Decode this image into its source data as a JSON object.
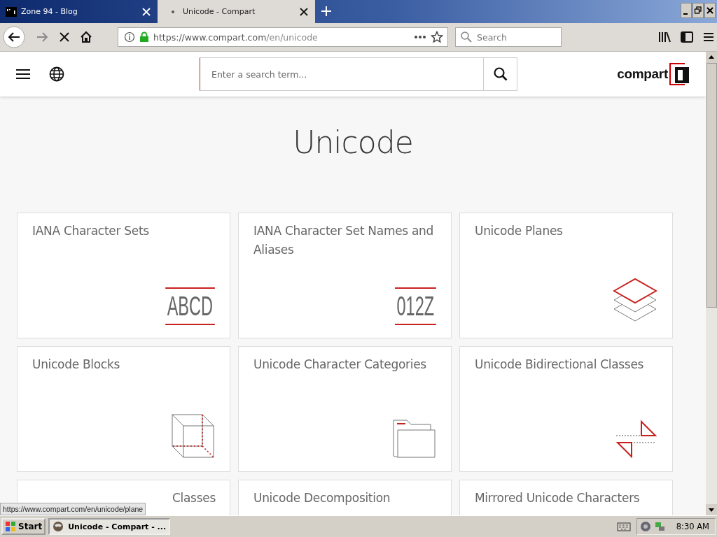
{
  "browser": {
    "tabs": [
      {
        "title": "Zone 94 - Blog",
        "selected": false
      },
      {
        "title": "Unicode - Compart",
        "selected": true,
        "loading": true
      }
    ],
    "url": {
      "host": "https://www.compart.com",
      "path": "/en/unicode"
    },
    "search_placeholder": "Search"
  },
  "site": {
    "search_placeholder": "Enter a search term...",
    "logo": "compart"
  },
  "page": {
    "title": "Unicode",
    "cards": [
      {
        "title": "IANA Character Sets",
        "kind": "letters",
        "glyphs": "ABCD"
      },
      {
        "title": "IANA Character Set Names and Aliases",
        "kind": "letters",
        "glyphs": "012Z"
      },
      {
        "title": "Unicode Planes",
        "kind": "planes"
      },
      {
        "title": "Unicode Blocks",
        "kind": "cube"
      },
      {
        "title": "Unicode Character Categories",
        "kind": "folder"
      },
      {
        "title": "Unicode Bidirectional Classes",
        "kind": "arrows"
      },
      {
        "title": "Classes",
        "kind": "covered"
      },
      {
        "title": "Unicode Decomposition",
        "kind": "plain"
      },
      {
        "title": "Mirrored Unicode Characters",
        "kind": "plain"
      }
    ]
  },
  "status_url": "https://www.compart.com/en/unicode/plane",
  "taskbar": {
    "start": "Start",
    "task": "Unicode - Compart - ...",
    "clock": "8:30 AM"
  }
}
